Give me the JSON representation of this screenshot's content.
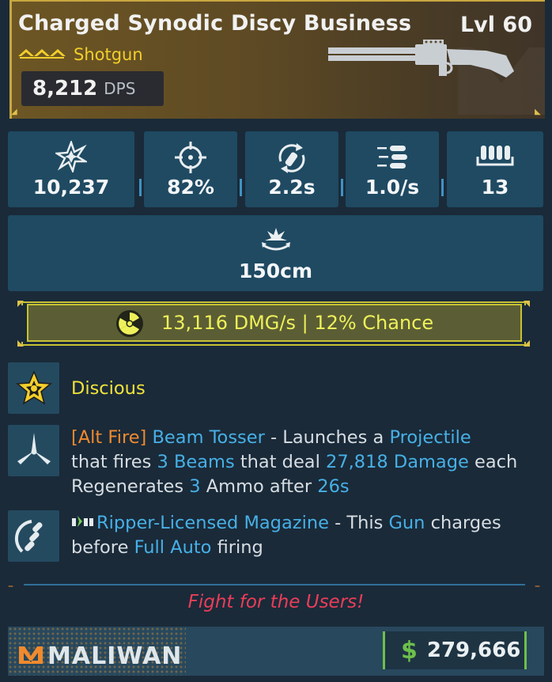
{
  "item": {
    "name": "Charged Synodic Discy Business",
    "level": "Lvl 60",
    "weapon_type": "Shotgun",
    "rarity_icon": "legendary-chevrons-icon",
    "dps_value": "8,212",
    "dps_unit": "DPS",
    "weapon_icon": "shotgun-icon",
    "manufacturer_watermark": "maliwan-logo-icon"
  },
  "stats": [
    {
      "icon": "damage-burst-icon",
      "value": "10,237"
    },
    {
      "icon": "crosshair-accuracy-icon",
      "value": "82%"
    },
    {
      "icon": "reload-time-icon",
      "value": "2.2s"
    },
    {
      "icon": "fire-rate-icon",
      "value": "1.0/s"
    },
    {
      "icon": "magazine-ammo-icon",
      "value": "13"
    },
    {
      "icon": "splash-radius-icon",
      "value": "150cm"
    }
  ],
  "elemental": {
    "icon": "radiation-icon",
    "text": "13,116 DMG/s | 12% Chance",
    "color": "#eef05a"
  },
  "perks": [
    {
      "icon": "discious-star-icon",
      "name": "Discious"
    },
    {
      "icon": "alt-fire-blades-icon",
      "tag": "[Alt Fire]",
      "name": "Beam Tosser",
      "t1": " - Launches a ",
      "h1": "Projectile",
      "t2": "that fires ",
      "h2": "3 Beams",
      "t3": " that deal ",
      "h3": "27,818 Damage",
      "t4": " each",
      "t5": "Regenerates ",
      "h4": "3",
      "t6": " Ammo after ",
      "h5": "26s"
    },
    {
      "icon": "magazine-bullets-icon",
      "prefix_icon": "ripper-logo-icon",
      "name": "Ripper-Licensed Magazine",
      "t1": " - This ",
      "h1": "Gun",
      "t2": " charges",
      "t3": "before ",
      "h2": "Full Auto",
      "t4": " firing"
    }
  ],
  "flavor_text": "Fight for the Users!",
  "footer": {
    "manufacturer": "MALIWAN",
    "currency_symbol": "$",
    "price": "279,666"
  },
  "colors": {
    "legendary_gold": "#c9a740",
    "highlight_blue": "#47b0e6",
    "alt_fire_orange": "#f08a2e",
    "flavor_red": "#ec3d58",
    "money_green": "#6dc04a"
  }
}
